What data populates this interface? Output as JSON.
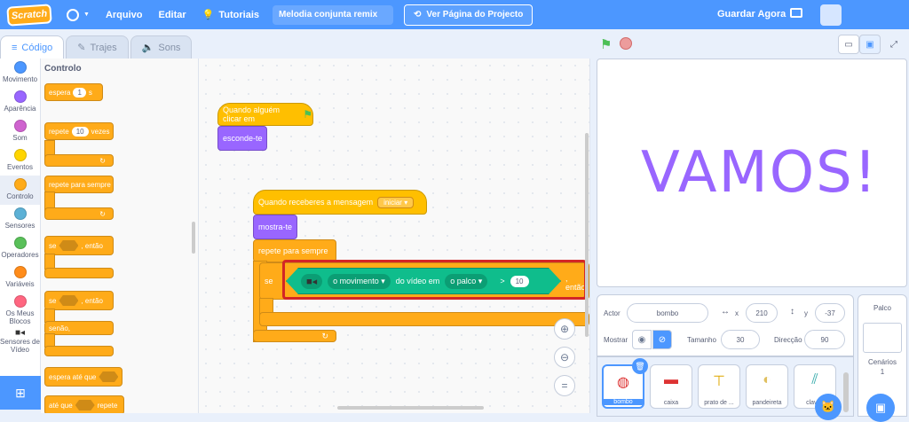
{
  "menubar": {
    "logo": "Scratch",
    "arquivo": "Arquivo",
    "editar": "Editar",
    "tutoriais": "Tutoriais",
    "project_title": "Melodia conjunta remix",
    "see_project": "Ver Página do Projecto",
    "save_now": "Guardar Agora"
  },
  "tabs": {
    "code": "Código",
    "costumes": "Trajes",
    "sounds": "Sons"
  },
  "categories": [
    {
      "label": "Movimento",
      "color": "#4c97ff"
    },
    {
      "label": "Aparência",
      "color": "#9966ff"
    },
    {
      "label": "Som",
      "color": "#cf63cf"
    },
    {
      "label": "Eventos",
      "color": "#ffd500"
    },
    {
      "label": "Controlo",
      "color": "#ffab19"
    },
    {
      "label": "Sensores",
      "color": "#5cb1d6"
    },
    {
      "label": "Operadores",
      "color": "#59c059"
    },
    {
      "label": "Variáveis",
      "color": "#ff8c1a"
    },
    {
      "label": "Os Meus Blocos",
      "color": "#ff6680"
    },
    {
      "label": "Sensores de Vídeo",
      "color": "#0fbd8c"
    }
  ],
  "palette": {
    "heading": "Controlo",
    "wait": "espera",
    "wait_val": "1",
    "wait_unit": "s",
    "repeat": "repete",
    "repeat_val": "10",
    "repeat_unit": "vezes",
    "forever": "repete para sempre",
    "if": "se",
    "then": ", então",
    "else": "senão,",
    "wait_until": "espera até que",
    "repeat_until": "até que",
    "repeat_until_end": "repete"
  },
  "script": {
    "when_flag": "Quando alguém clicar em",
    "hide": "esconde-te",
    "when_receive": "Quando receberes a mensagem",
    "message": "iniciar",
    "show": "mostra-te",
    "forever": "repete para sempre",
    "if": "se",
    "motion_option": "o movimento",
    "on_video": "do vídeo em",
    "target_option": "o palco",
    "gt": ">",
    "compare_value": "10",
    "then": ", então"
  },
  "stage": {
    "text": "VAMOS!"
  },
  "sprite_info": {
    "actor_label": "Actor",
    "name": "bombo",
    "x": "210",
    "y": "-37",
    "show_label": "Mostrar",
    "size_label": "Tamanho",
    "size": "30",
    "direction_label": "Direcção",
    "direction": "90"
  },
  "sprites": [
    "bombo",
    "caixa",
    "prato de ...",
    "pandeireta",
    "claves"
  ],
  "stage_panel": {
    "title": "Palco",
    "backdrops_label": "Cenários",
    "backdrops_count": "1"
  }
}
